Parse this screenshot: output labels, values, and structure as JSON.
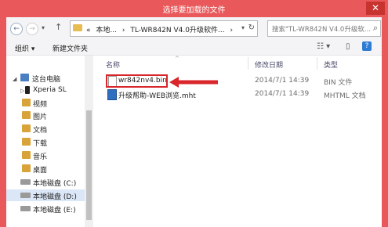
{
  "window": {
    "title": "选择要加载的文件",
    "close_glyph": "✕"
  },
  "address": {
    "back_glyph": "←",
    "forward_glyph": "→",
    "recent_glyph": "▾",
    "up_glyph": "↑",
    "path_prefix": "«",
    "segments": [
      "本地...",
      "TL-WR842N V4.0升级软件..."
    ],
    "separator": "›",
    "dropdown_glyph": "▾",
    "refresh_glyph": "↻"
  },
  "search": {
    "placeholder": "搜索\"TL-WR842N V4.0升级软...",
    "icon": "search-icon",
    "icon_glyph": "⌕"
  },
  "toolbar": {
    "organize_label": "组织 ▾",
    "new_folder_label": "新建文件夹",
    "view_glyph": "☷ ▾",
    "preview_glyph": "▯",
    "help_glyph": "?"
  },
  "sidebar": {
    "items": [
      {
        "label": "这台电脑",
        "icon": "computer-icon",
        "color": "#4a7fc1"
      },
      {
        "label": "Xperia SL",
        "icon": "phone-icon",
        "color": "#222222"
      },
      {
        "label": "视频",
        "icon": "video-folder-icon",
        "color": "#d8a43a"
      },
      {
        "label": "图片",
        "icon": "pictures-folder-icon",
        "color": "#d8a43a"
      },
      {
        "label": "文档",
        "icon": "documents-folder-icon",
        "color": "#d8a43a"
      },
      {
        "label": "下载",
        "icon": "downloads-folder-icon",
        "color": "#d8a43a"
      },
      {
        "label": "音乐",
        "icon": "music-folder-icon",
        "color": "#d8a43a"
      },
      {
        "label": "桌面",
        "icon": "desktop-folder-icon",
        "color": "#d8a43a"
      },
      {
        "label": "本地磁盘 (C:)",
        "icon": "drive-icon",
        "color": "#9a9a9a"
      },
      {
        "label": "本地磁盘 (D:)",
        "icon": "drive-icon",
        "color": "#9a9a9a"
      },
      {
        "label": "本地磁盘 (E:)",
        "icon": "drive-icon",
        "color": "#9a9a9a"
      }
    ],
    "collapse_glyph": "◢",
    "expand_glyph": "▷"
  },
  "columns": {
    "name": "名称",
    "modified": "修改日期",
    "type": "类型",
    "sort_glyph": "^"
  },
  "files": [
    {
      "name": "wr842nv4.bin",
      "modified": "2014/7/1 14:39",
      "type": "BIN 文件"
    },
    {
      "name": "升级帮助-WEB浏览.mht",
      "modified": "2014/7/1 14:39",
      "type": "MHTML 文档"
    }
  ],
  "colors": {
    "titlebar": "#e9585a",
    "highlight": "#d8262b",
    "accent": "#4a7fc1"
  }
}
